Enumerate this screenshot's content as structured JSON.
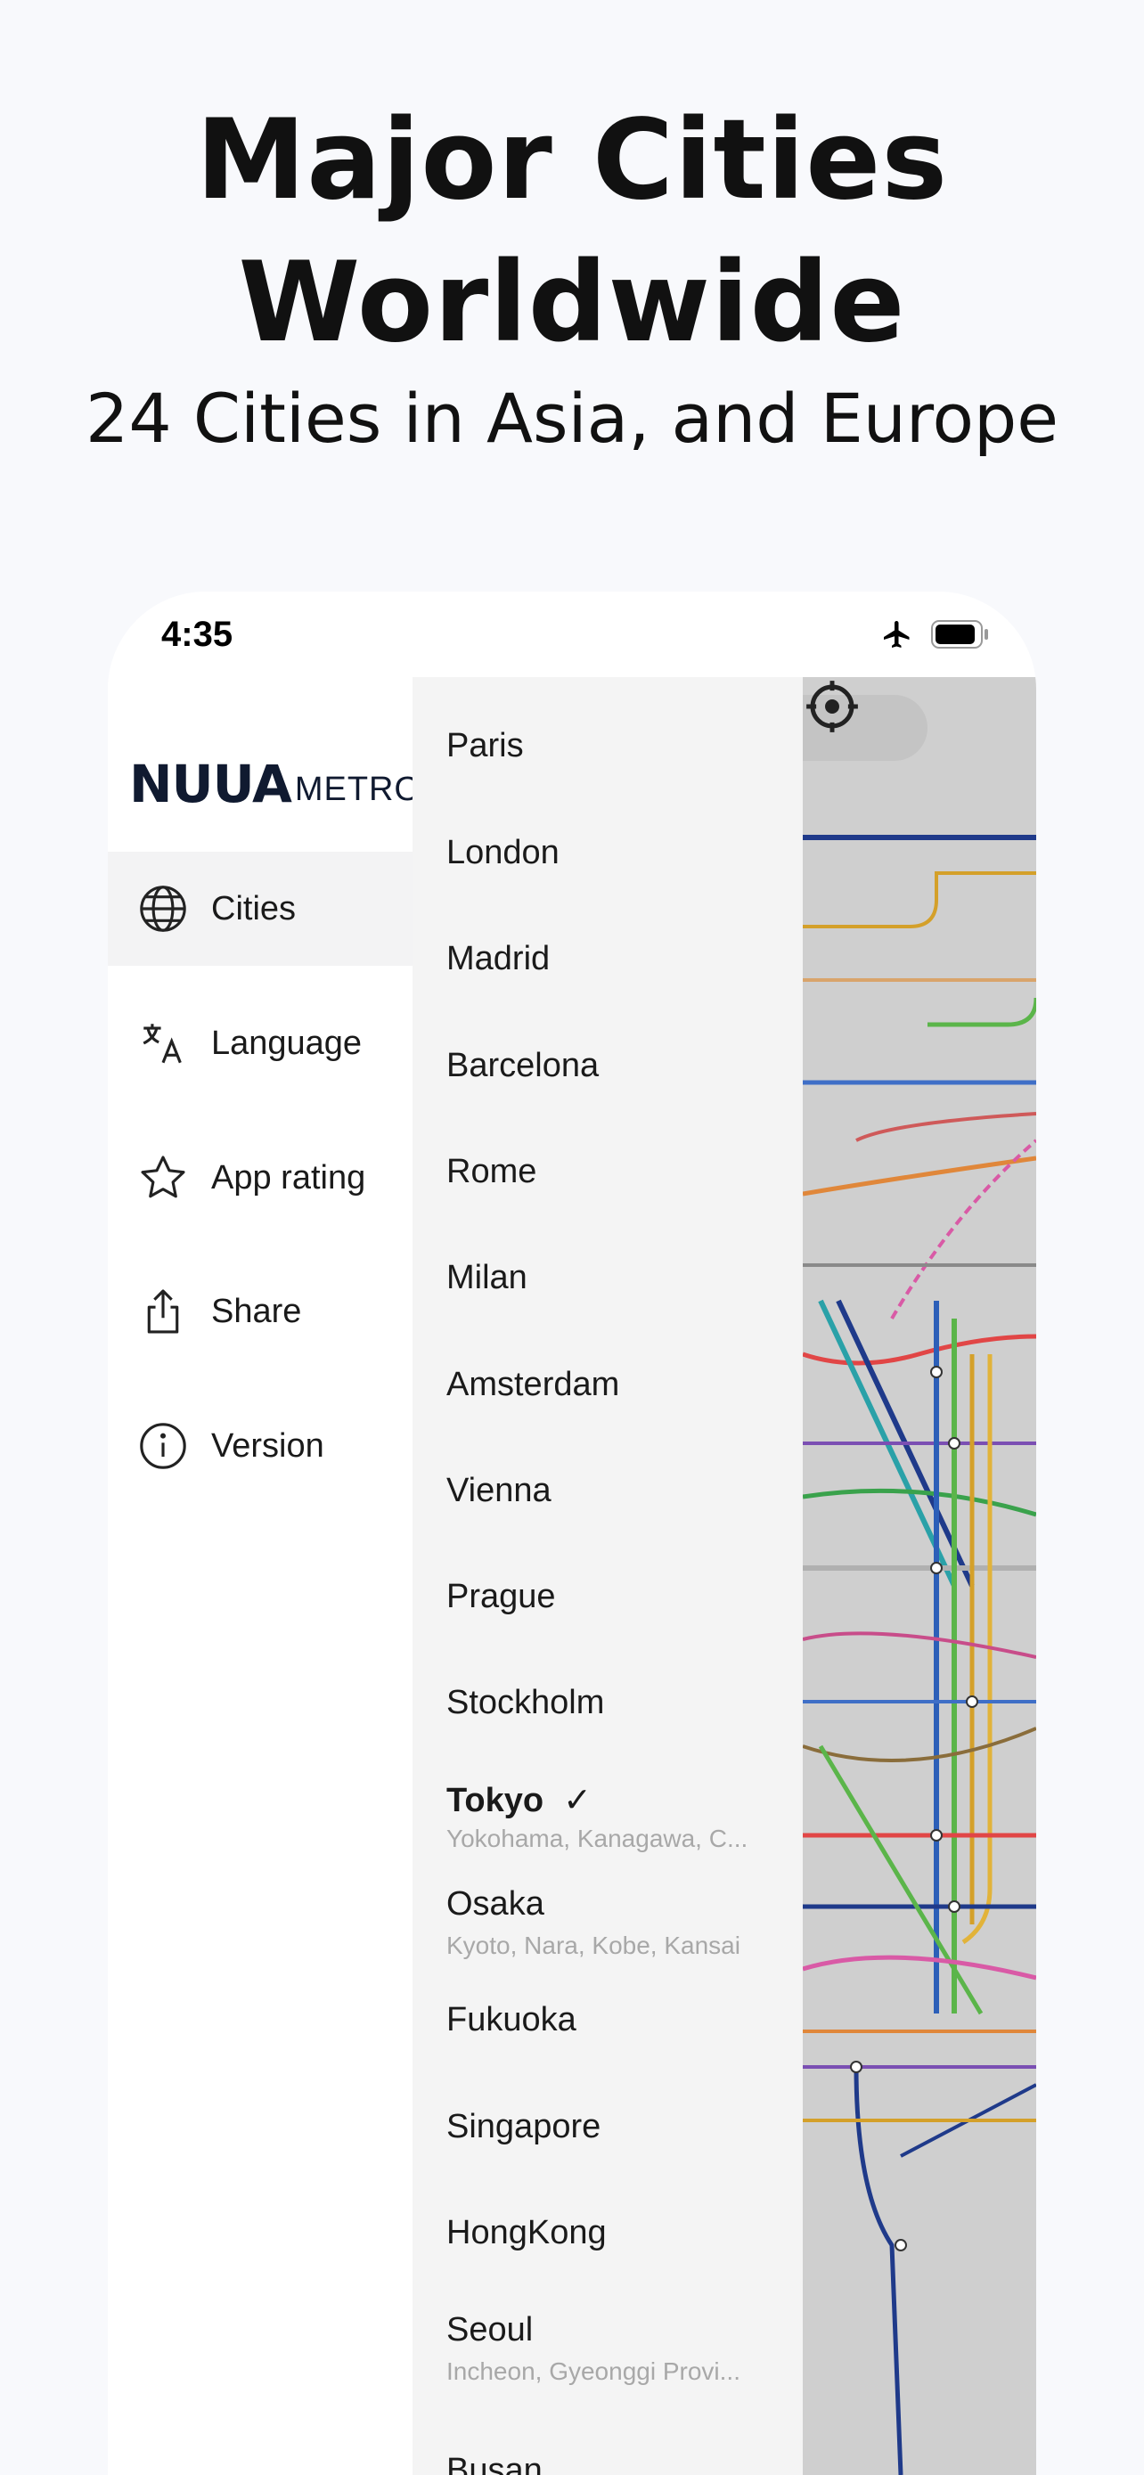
{
  "headline": {
    "line1": "Major Cities",
    "line2": "Worldwide"
  },
  "subheadline": "24 Cities in Asia, and Europe",
  "status_bar": {
    "time": "4:35"
  },
  "logo": {
    "main": "NUUA",
    "sub": "METRO"
  },
  "menu": [
    {
      "label": "Cities",
      "icon": "globe-icon",
      "active": true
    },
    {
      "label": "Language",
      "icon": "translate-icon",
      "active": false
    },
    {
      "label": "App rating",
      "icon": "star-icon",
      "active": false
    },
    {
      "label": "Share",
      "icon": "share-icon",
      "active": false
    },
    {
      "label": "Version",
      "icon": "info-icon",
      "active": false
    }
  ],
  "cities": [
    {
      "name": "Paris"
    },
    {
      "name": "London"
    },
    {
      "name": "Madrid"
    },
    {
      "name": "Barcelona"
    },
    {
      "name": "Rome"
    },
    {
      "name": "Milan"
    },
    {
      "name": "Amsterdam"
    },
    {
      "name": "Vienna"
    },
    {
      "name": "Prague"
    },
    {
      "name": "Stockholm"
    },
    {
      "name": "Tokyo",
      "selected": true,
      "sub": "Yokohama, Kanagawa, C..."
    },
    {
      "name": "Osaka",
      "sub": "Kyoto, Nara, Kobe, Kansai"
    },
    {
      "name": "Fukuoka"
    },
    {
      "name": "Singapore"
    },
    {
      "name": "HongKong"
    },
    {
      "name": "Seoul",
      "sub": "Incheon, Gyeonggi Provi..."
    },
    {
      "name": "Busan"
    }
  ],
  "check_mark": "✓",
  "colors": {
    "background": "#f8f9fc",
    "list_bg": "#f4f4f4",
    "active_menu_bg": "#f3f3f4",
    "logo": "#101a30"
  }
}
